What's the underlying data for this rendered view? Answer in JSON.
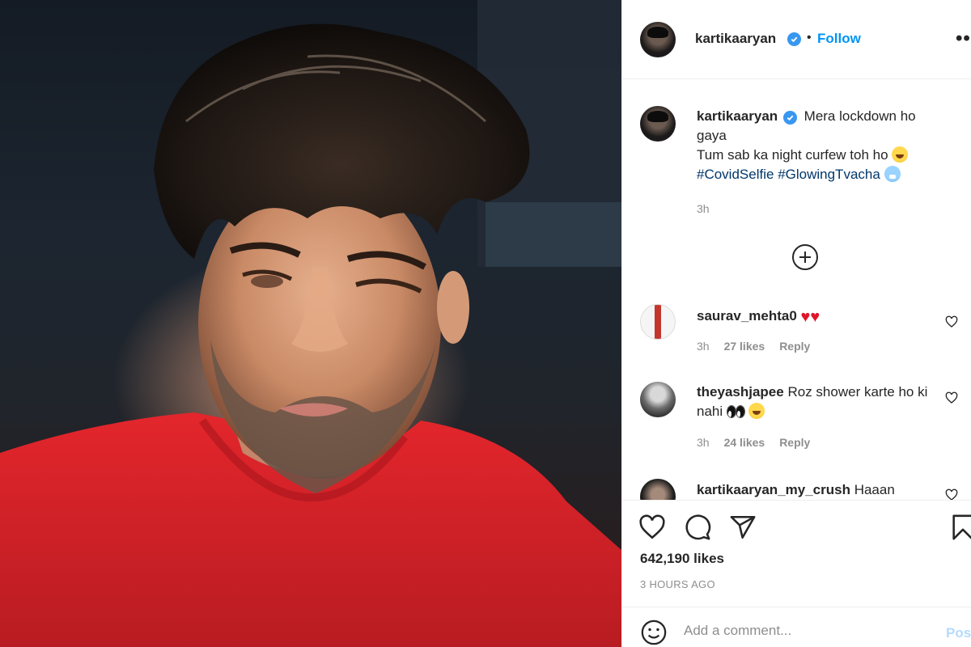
{
  "post": {
    "image_alt": "selfie photo"
  },
  "header": {
    "username": "kartikaaryan",
    "separator": "•",
    "follow_label": "Follow",
    "more_label": "•••"
  },
  "caption": {
    "username": "kartikaaryan",
    "line1": "Mera lockdown ho gaya",
    "line2": "Tum sab ka night curfew toh ho",
    "hashtag1": "#CovidSelfie",
    "hashtag2": "#GlowingTvacha",
    "time": "3h"
  },
  "comments": [
    {
      "username": "saurav_mehta0",
      "text": "",
      "time": "3h",
      "likes": "27 likes",
      "reply": "Reply"
    },
    {
      "username": "theyashjapee",
      "text": "Roz shower karte ho ki nahi",
      "time": "3h",
      "likes": "24 likes",
      "reply": "Reply"
    },
    {
      "username": "kartikaaryan_my_crush",
      "text": "Haaan",
      "time": "",
      "likes": "",
      "reply": ""
    }
  ],
  "actions": {
    "likes_count": "642,190 likes",
    "time_ago": "3 HOURS AGO"
  },
  "add_comment": {
    "placeholder": "Add a comment...",
    "post_label": "Post"
  },
  "colors": {
    "accent": "#0095f6",
    "verified": "#3897f0",
    "hashtag": "#00376b",
    "muted": "#8e8e8e",
    "shirt": "#d8252b"
  }
}
